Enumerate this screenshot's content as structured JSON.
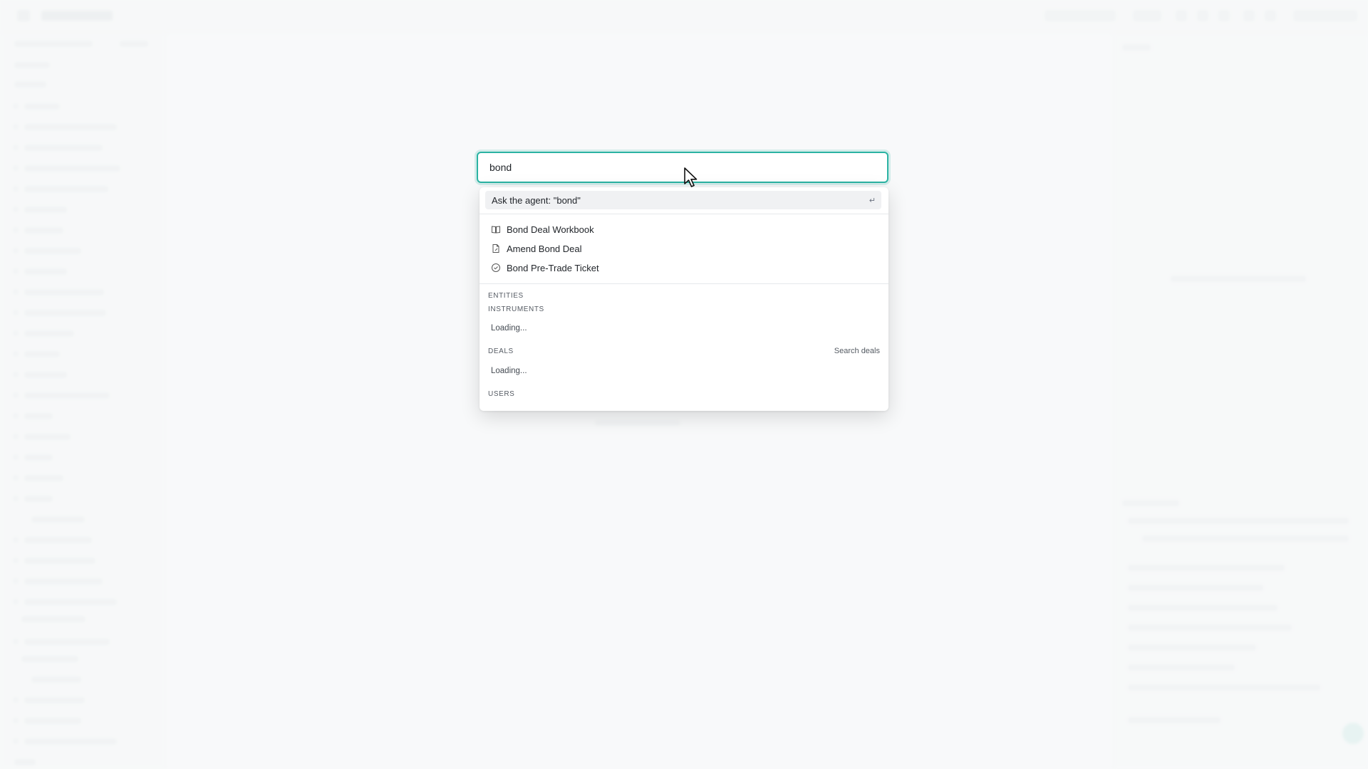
{
  "search": {
    "value": "bond"
  },
  "ask": {
    "label": "Ask the agent: \"bond\"",
    "enter_glyph": "↵"
  },
  "results": [
    {
      "label": "Bond Deal Workbook",
      "icon": "book-icon"
    },
    {
      "label": "Amend Bond Deal",
      "icon": "file-edit-icon"
    },
    {
      "label": "Bond Pre-Trade Ticket",
      "icon": "check-circle-icon"
    }
  ],
  "sections": {
    "entities": "ENTITIES",
    "instruments": "INSTRUMENTS",
    "instruments_loading": "Loading...",
    "deals": "DEALS",
    "deals_action": "Search deals",
    "deals_loading": "Loading...",
    "users": "USERS"
  },
  "colors": {
    "accent": "#2bb3a3",
    "highlight_row": "#f0f1f3"
  }
}
